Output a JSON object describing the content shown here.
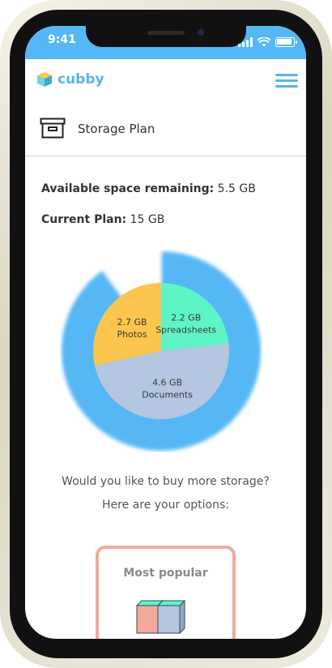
{
  "status_bar": {
    "time": "9:41"
  },
  "app": {
    "name": "cubby"
  },
  "page": {
    "title": "Storage Plan"
  },
  "storage": {
    "available_label": "Available space remaining:",
    "available_value": "5.5 GB",
    "plan_label": "Current Plan:",
    "plan_value": "15 GB"
  },
  "chart_data": {
    "type": "pie",
    "total_gb": 15,
    "slices": [
      {
        "label": "Spreadsheets",
        "value": 2.2,
        "value_label": "2.2 GB",
        "color": "#5ef5c6"
      },
      {
        "label": "Documents",
        "value": 4.6,
        "value_label": "4.6 GB",
        "color": "#b5c6e0"
      },
      {
        "label": "Photos",
        "value": 2.7,
        "value_label": "2.7 GB",
        "color": "#fcc54e"
      }
    ],
    "ring": {
      "used_gb": 13.5,
      "used_color": "#55b8f5",
      "free_color": "#ffffff"
    }
  },
  "upsell": {
    "question_line1": "Would you like to buy more storage?",
    "question_line2": "Here are your options:"
  },
  "plans": [
    {
      "badge": "Most popular",
      "border_color": "#f2a99c"
    }
  ]
}
